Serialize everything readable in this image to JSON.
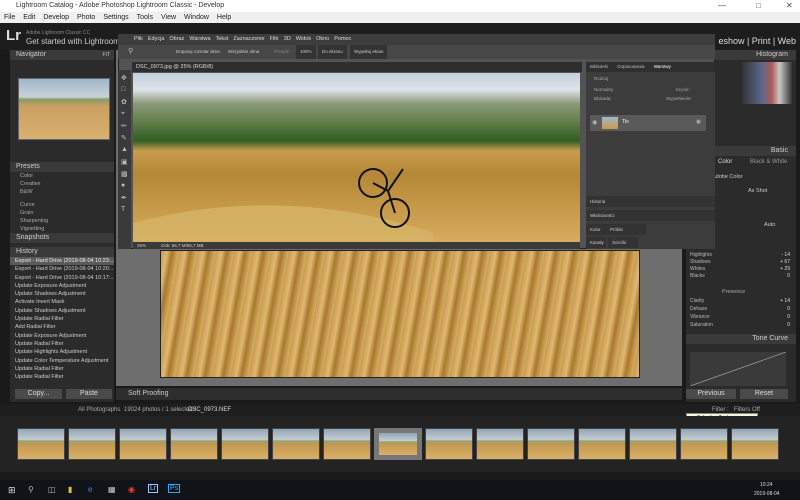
{
  "window": {
    "title": "Lightroom Catalog - Adobe Photoshop Lightroom Classic - Develop"
  },
  "menu": [
    "File",
    "Edit",
    "Develop",
    "Photo",
    "Settings",
    "Tools",
    "View",
    "Window",
    "Help"
  ],
  "lr": {
    "logo": "Lr",
    "sub1": "Adobe Lightroom Classic CC",
    "sub2": "Get started with Lightroom",
    "modules": "eshow | Print | Web"
  },
  "left": {
    "navigator": "Navigator",
    "nav_zoom": "FIT",
    "presets": "Presets",
    "preset_items": [
      "Color",
      "Creative",
      "B&W",
      "Curve",
      "Grain",
      "Sharpening",
      "Vignetting"
    ],
    "snapshots": "Snapshots",
    "history": "History",
    "history_items": [
      "Export - Hard Drive (2019-08-04 10:23:...",
      "Export - Hard Drive (2019-08-04 10:20:...",
      "Export - Hard Drive (2019-08-04 10:17:...",
      "Update Exposure Adjustment",
      "Update Shadows Adjustment",
      "Activate Invert Mask",
      "Update Shadows Adjustment",
      "Update Radial Filter",
      "Add Radial Filter",
      "Update Exposure Adjustment",
      "Update Radial Filter",
      "Update Highlights Adjustment",
      "Update Color Temperature Adjustment",
      "Update Radial Filter",
      "Update Radial Filter"
    ],
    "copy": "Copy...",
    "paste": "Paste"
  },
  "center": {
    "soft_proofing": "Soft Proofing"
  },
  "right": {
    "histogram": "Histogram",
    "basic": "Basic",
    "color": "Color",
    "bw": "Black & White",
    "profile": "Adobe Color",
    "wb": "As Shot",
    "tone_curve": "Tone Curve",
    "presence": "Presence",
    "rows": [
      {
        "label": "Highlights",
        "value": "- 14"
      },
      {
        "label": "Shadows",
        "value": "+ 67"
      },
      {
        "label": "Whites",
        "value": "+ 29"
      },
      {
        "label": "Blacks",
        "value": "0"
      },
      {
        "label": "Clarity",
        "value": "+ 14"
      },
      {
        "label": "Dehaze",
        "value": "0"
      },
      {
        "label": "Vibrance",
        "value": "0"
      },
      {
        "label": "Saturation",
        "value": "0"
      }
    ],
    "previous": "Previous",
    "reset": "Reset",
    "auto": "Auto"
  },
  "filmbar": {
    "source": "All Photographs",
    "count": "19024 photos / 1 selected /",
    "file": "DSC_0973.NEF",
    "filter": "Filter :",
    "filter_val": "Filters Off",
    "tooltip": "Selective Tool"
  },
  "ps": {
    "menu": [
      "Plik",
      "Edycja",
      "Obraz",
      "Warstwa",
      "Tekst",
      "Zaznaczenie",
      "Filtr",
      "3D",
      "Widok",
      "Okno",
      "Pomoc"
    ],
    "opts": [
      "Dopasuj rozmiar okna",
      "Wszystkie okna",
      "Przejdź",
      "100%",
      "Do ekranu",
      "Wypełnij ekran"
    ],
    "tab": "DSC_0973.jpg @ 25% (RGB/8)",
    "status_zoom": "25%",
    "status_doc": "Dok: 66,7 M/66,7 MB",
    "panel_tabs": [
      "Biblioteki",
      "Dopasowania",
      "Warstwy"
    ],
    "kind": "Rodzaj",
    "mode": "Normalny",
    "opacity": "Krycie:",
    "lock": "Blokada:",
    "fill": "Wypełnienie:",
    "layer": "Tło",
    "bottom_tabs": [
      "Historia",
      "Właściwości",
      "Kolor",
      "Próbki",
      "Kanały",
      "Ścieżki"
    ]
  },
  "taskbar": {
    "time": "10:24",
    "date": "2019-08-04"
  }
}
